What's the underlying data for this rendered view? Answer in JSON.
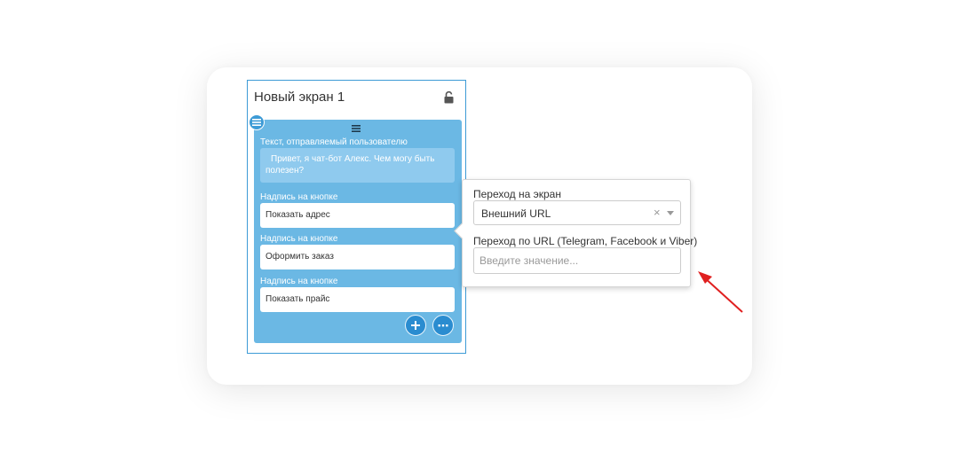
{
  "screen": {
    "title": "Новый экран 1"
  },
  "block": {
    "text_label": "Текст, отправляемый пользователю",
    "message": "Привет, я чат-бот Алекс. Чем могу быть полезен?",
    "buttons": [
      {
        "label": "Надпись на кнопке",
        "value": "Показать адрес"
      },
      {
        "label": "Надпись на кнопке",
        "value": "Оформить заказ"
      },
      {
        "label": "Надпись на кнопке",
        "value": "Показать прайс"
      }
    ]
  },
  "popover": {
    "target_label": "Переход на экран",
    "target_value": "Внешний URL",
    "url_label": "Переход по URL (Telegram, Facebook и Viber)",
    "url_placeholder": "Введите значение...",
    "url_value": ""
  },
  "icons": {
    "lock": "lock-open-icon",
    "handle": "drag-handle-icon",
    "menu": "menu-icon",
    "add": "plus-icon",
    "more": "more-icon",
    "clear": "close-icon",
    "caret": "chevron-down-icon",
    "annotation": "arrow-icon"
  },
  "colors": {
    "accent": "#3d9bd6",
    "block_bg": "#6bb8e4",
    "round_button": "#2a8cd0",
    "annotation_arrow": "#e02020"
  }
}
